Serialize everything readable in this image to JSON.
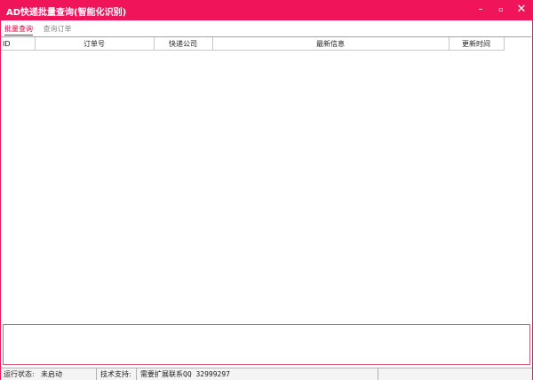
{
  "window": {
    "title": "AD快递批量查询(智能化识别)",
    "controls": {
      "minimize": "–",
      "maximize": "▫",
      "close": "✕"
    }
  },
  "tabs": [
    {
      "label": "批量查询",
      "active": true
    },
    {
      "label": "查询订单",
      "active": false
    }
  ],
  "table": {
    "columns": [
      "ID",
      "订单号",
      "快递公司",
      "最新信息",
      "更新时间"
    ],
    "rows": []
  },
  "status_bar": {
    "run_status_label": "运行状态:",
    "run_status_value": "未启动",
    "support_label": "技术支持:",
    "support_value": "需要扩展联系QQ 32999297"
  },
  "colors": {
    "accent": "#f0145a",
    "active_tab": "#e8003c"
  }
}
